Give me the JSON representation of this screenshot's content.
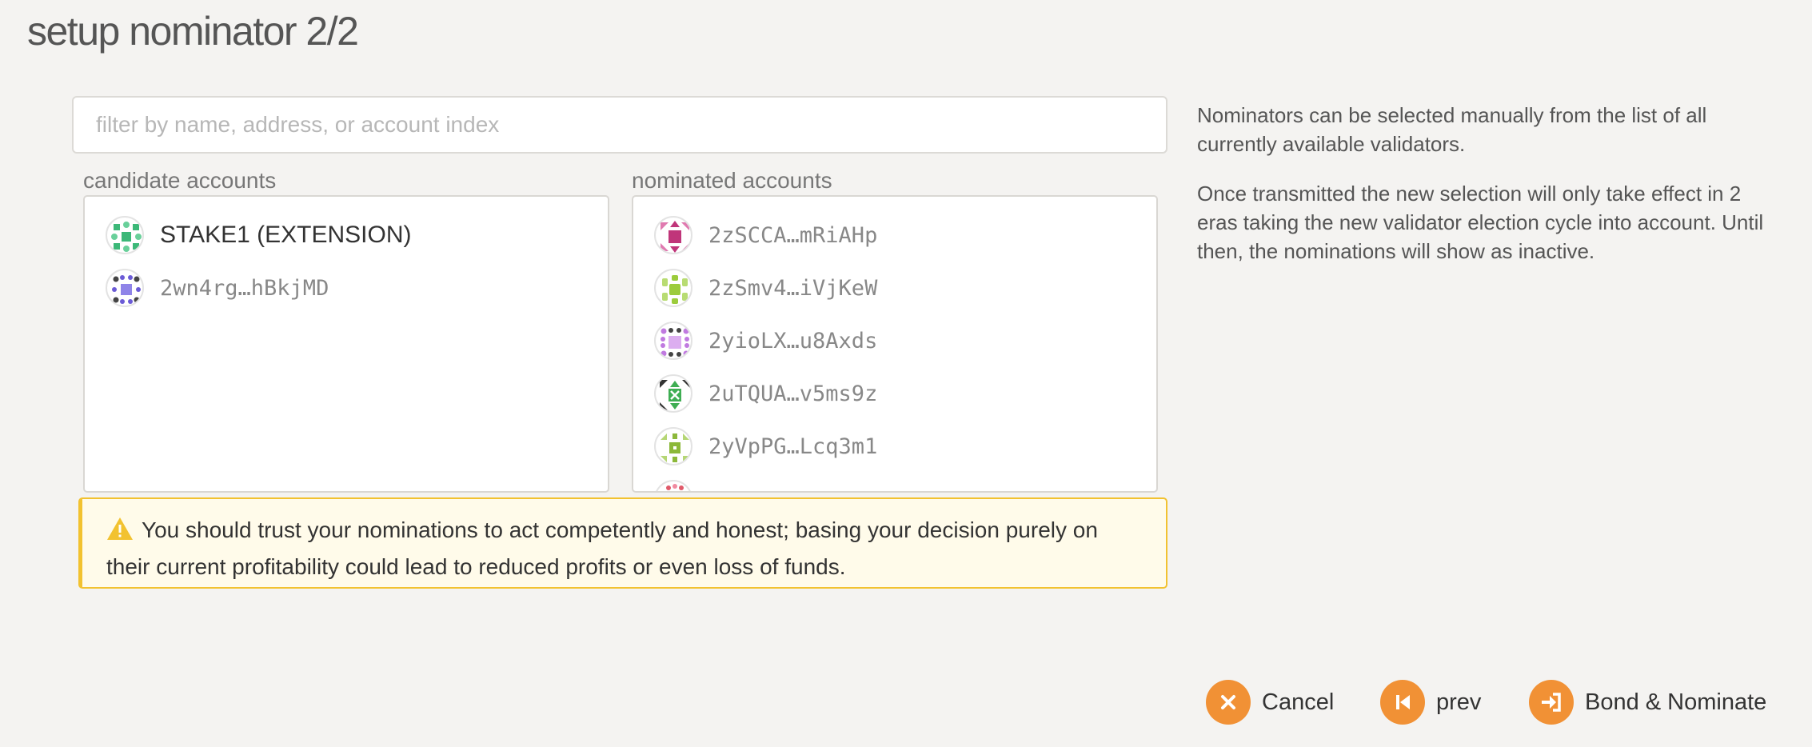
{
  "page": {
    "title": "setup nominator 2/2"
  },
  "search": {
    "placeholder": "filter by name, address, or account index"
  },
  "candidates": {
    "label": "candidate accounts",
    "items": [
      {
        "name": "STAKE1 (EXTENSION)",
        "identicon_color": "#3cb878"
      },
      {
        "name": "2wn4rg…hBkjMD",
        "identicon_color": "#6b5bd6"
      }
    ]
  },
  "nominated": {
    "label": "nominated accounts",
    "items": [
      {
        "address": "2zSCCA…mRiAHp",
        "identicon_color": "#c0357a"
      },
      {
        "address": "2zSmv4…iVjKeW",
        "identicon_color": "#9ccc3c"
      },
      {
        "address": "2yioLX…u8Axds",
        "identicon_color": "#c07ae0"
      },
      {
        "address": "2uTQUA…v5ms9z",
        "identicon_color": "#3fae53"
      },
      {
        "address": "2yVpPG…Lcq3m1",
        "identicon_color": "#8cb83a"
      }
    ]
  },
  "warning": {
    "text": "You should trust your nominations to act competently and honest; basing your decision purely on their current profitability could lead to reduced profits or even loss of funds.",
    "color": "#f2c230"
  },
  "help": {
    "para1": "Nominators can be selected manually from the list of all currently available validators.",
    "para2": "Once transmitted the new selection will only take effect in 2 eras taking the new validator election cycle into account. Until then, the nominations will show as inactive."
  },
  "actions": {
    "cancel": "Cancel",
    "prev": "prev",
    "bond": "Bond & Nominate",
    "accent": "#f19135"
  }
}
